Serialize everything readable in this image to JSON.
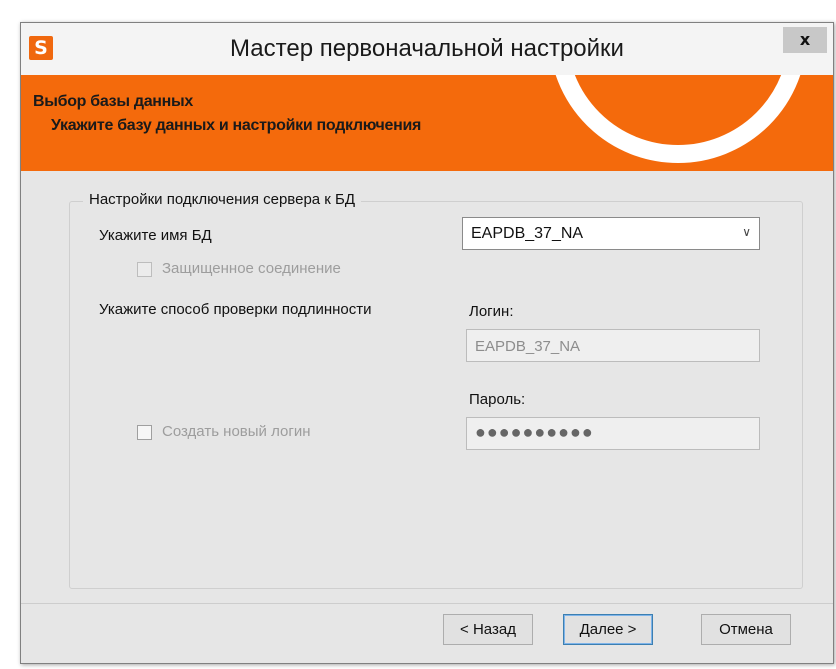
{
  "window": {
    "title": "Мастер первоначальной настройки",
    "app_icon_letter": "S",
    "close_glyph": "x"
  },
  "banner": {
    "title": "Выбор базы данных",
    "subtitle": "Укажите базу данных и настройки подключения"
  },
  "group": {
    "legend": "Настройки подключения сервера к БД",
    "db_name_label": "Укажите имя БД",
    "db_name_value": "EAPDB_37_NA",
    "secure_connection_label": "Защищенное соединение",
    "auth_method_label": "Укажите способ проверки подлинности",
    "login_label": "Логин:",
    "login_value": "EAPDB_37_NA",
    "password_label": "Пароль:",
    "password_value": "●●●●●●●●●●",
    "create_login_label": "Создать новый логин"
  },
  "buttons": {
    "back": "< Назад",
    "next": "Далее >",
    "cancel": "Отмена"
  },
  "icons": {
    "chevron": "chevron-down-icon"
  },
  "colors": {
    "accent": "#f46a0c",
    "window_bg": "#e6e6e6"
  }
}
